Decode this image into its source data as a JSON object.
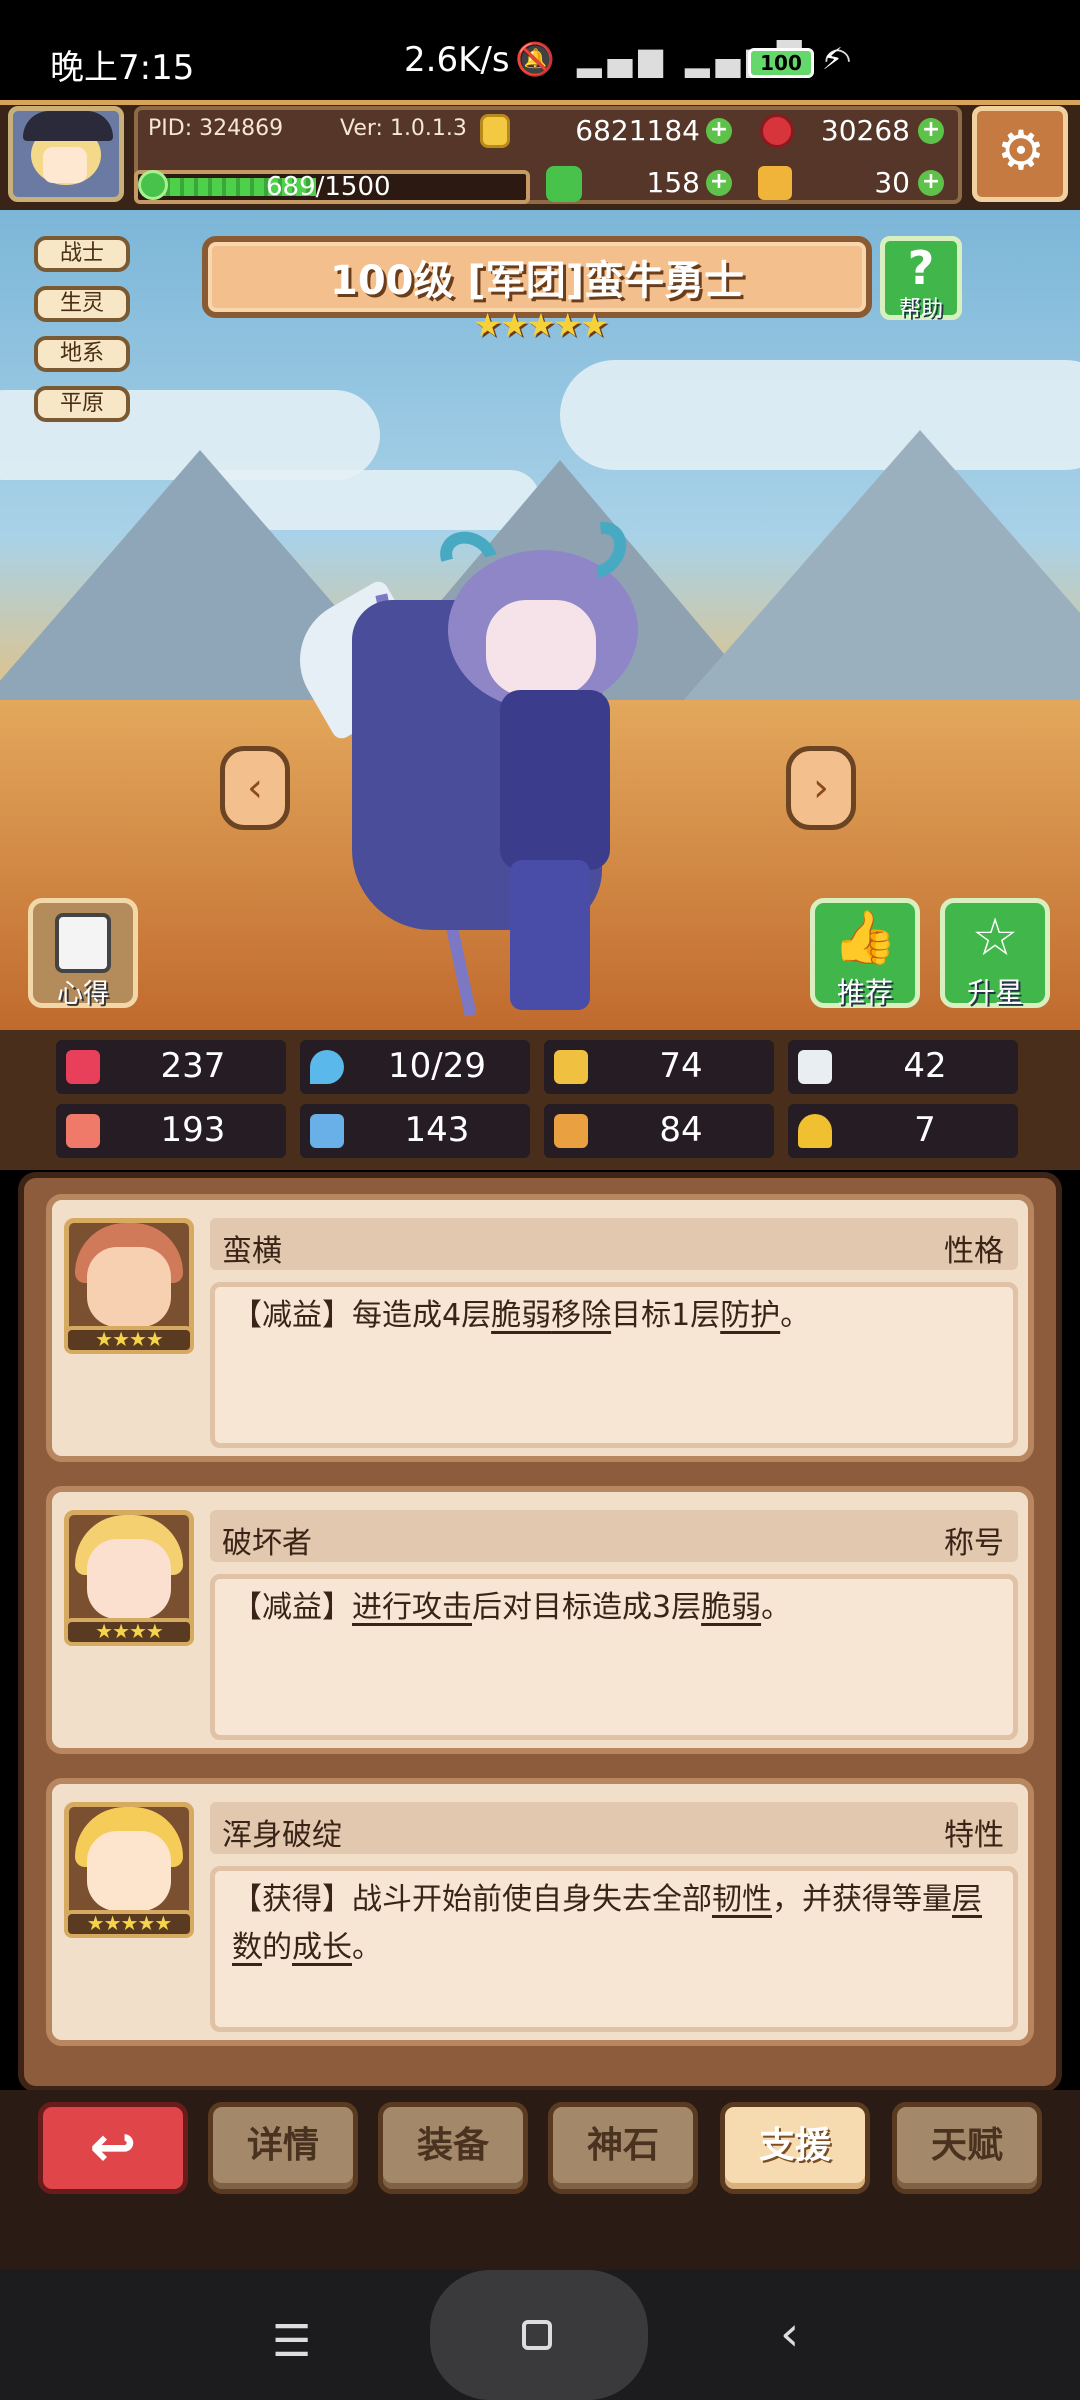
{
  "status_bar": {
    "time": "晚上7:15",
    "network_speed": "2.6K/s",
    "battery": "100"
  },
  "header": {
    "pid": "PID: 324869",
    "version": "Ver: 1.0.1.3",
    "xp": "689/1500",
    "xp_fraction": 0.459,
    "currencies": {
      "gold": "6821184",
      "gems": "30268",
      "clover": "158",
      "keys": "30"
    }
  },
  "hero": {
    "tags": [
      "战士",
      "生灵",
      "地系",
      "平原"
    ],
    "title": "100级 [军团]蛮牛勇士",
    "star_count": 5,
    "stars": "★★★★★",
    "help_label": "帮助",
    "notes_label": "心得",
    "recommend_label": "推荐",
    "upgrade_label": "升星"
  },
  "stats": [
    {
      "icon": "heart-icon",
      "value": "237",
      "color": "#e8405a"
    },
    {
      "icon": "drop-icon",
      "value": "10/29",
      "color": "#5ab8ea"
    },
    {
      "icon": "shield-icon",
      "value": "74",
      "color": "#f0c040"
    },
    {
      "icon": "wing-icon",
      "value": "42",
      "color": "#e8eef2"
    },
    {
      "icon": "fist-icon",
      "value": "193",
      "color": "#f07a6a"
    },
    {
      "icon": "book-icon",
      "value": "143",
      "color": "#6ab0e8"
    },
    {
      "icon": "boot-icon",
      "value": "84",
      "color": "#e8a040"
    },
    {
      "icon": "horseshoe-icon",
      "value": "7",
      "color": "#f0c030"
    }
  ],
  "supports": [
    {
      "name": "蛮横",
      "type": "性格",
      "stars": "★★★★",
      "desc_parts": [
        "【减益】每造成4层",
        "脆弱",
        "移除",
        "目标1层",
        "防护",
        "。"
      ]
    },
    {
      "name": "破坏者",
      "type": "称号",
      "stars": "★★★★",
      "desc_parts": [
        "【减益】",
        "进行攻击",
        "后对目标造成3层",
        "脆弱",
        "。"
      ]
    },
    {
      "name": "浑身破绽",
      "type": "特性",
      "stars": "★★★★★",
      "desc_parts": [
        "【获得】战斗开始前使自身失去全部",
        "韧性",
        "，并获得等量",
        "层数",
        "的",
        "成长",
        "。"
      ]
    }
  ],
  "tabs": {
    "back_icon": "back-arrow-icon",
    "items": [
      "详情",
      "装备",
      "神石",
      "支援",
      "天赋"
    ],
    "active": "支援"
  }
}
